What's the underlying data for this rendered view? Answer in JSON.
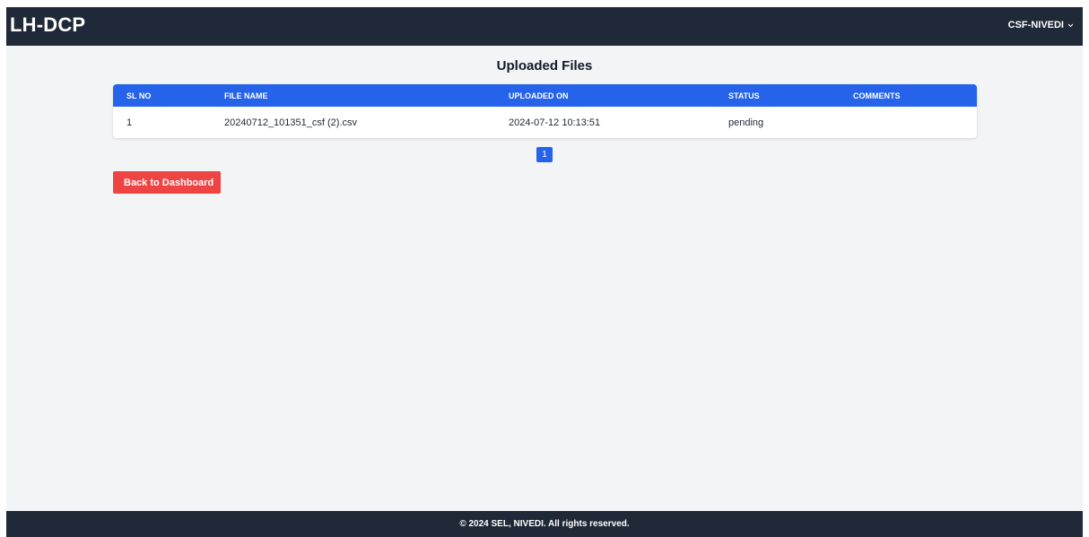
{
  "header": {
    "brand": "LH-DCP",
    "user": "CSF-NIVEDI"
  },
  "main": {
    "title": "Uploaded Files",
    "table": {
      "columns": [
        "SL NO",
        "FILE NAME",
        "UPLOADED ON",
        "STATUS",
        "COMMENTS"
      ],
      "rows": [
        {
          "sl_no": "1",
          "file_name": "20240712_101351_csf (2).csv",
          "uploaded_on": "2024-07-12 10:13:51",
          "status": "pending",
          "comments": ""
        }
      ]
    },
    "pagination": {
      "current_page": "1"
    },
    "back_button": "Back to Dashboard"
  },
  "footer": {
    "text": "© 2024 SEL, NIVEDI. All rights reserved."
  },
  "colors": {
    "navbar": "#1f2937",
    "page_bg": "#f3f4f6",
    "table_header": "#2563eb",
    "back_button": "#ef4444"
  }
}
